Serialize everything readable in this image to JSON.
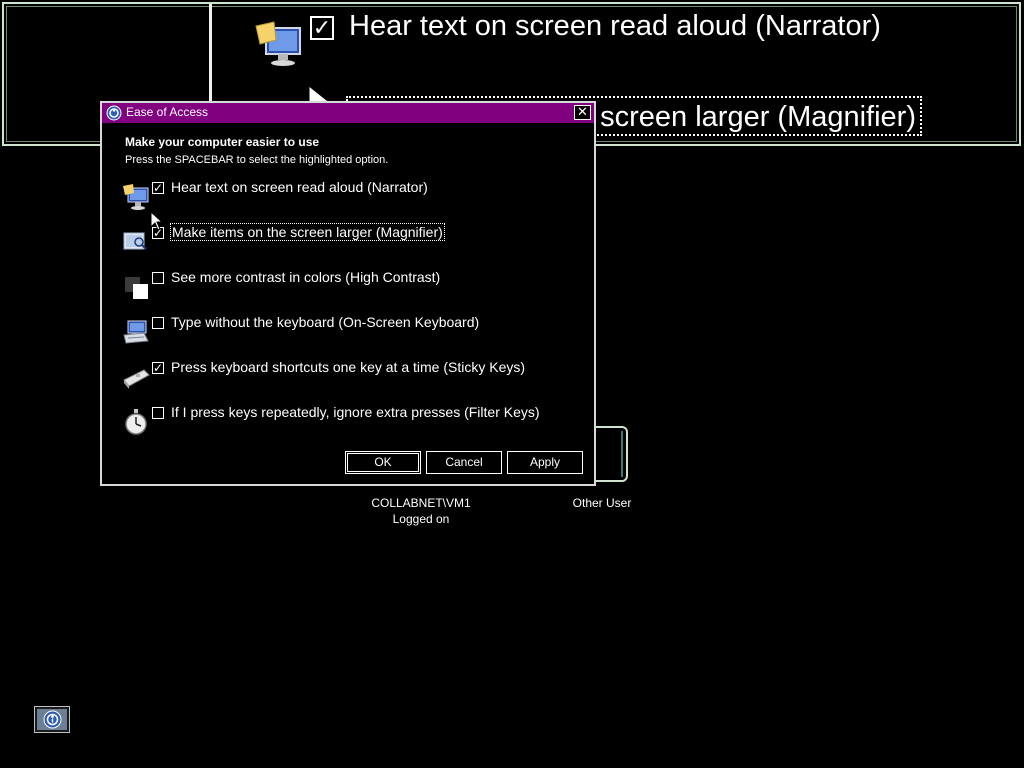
{
  "magnifier": {
    "line1": "Hear text on screen read aloud (Narrator)",
    "line2": "screen larger (Magnifier)",
    "line1_checked": true
  },
  "dialog": {
    "title": "Ease of Access",
    "close_label": "✕",
    "heading": "Make your computer easier to use",
    "subheading": "Press the SPACEBAR to select the highlighted option.",
    "options": [
      {
        "label": "Hear text on screen read aloud (Narrator)",
        "checked": true,
        "icon": "narrator-icon"
      },
      {
        "label": "Make items on the screen larger (Magnifier)",
        "checked": true,
        "icon": "magnifier-icon",
        "focused": true
      },
      {
        "label": "See more contrast in colors (High Contrast)",
        "checked": false,
        "icon": "high-contrast-icon"
      },
      {
        "label": "Type without the keyboard (On-Screen Keyboard)",
        "checked": false,
        "icon": "on-screen-keyboard-icon"
      },
      {
        "label": "Press keyboard shortcuts one key at a time (Sticky Keys)",
        "checked": true,
        "icon": "sticky-keys-icon"
      },
      {
        "label": "If I press keys repeatedly, ignore extra presses (Filter Keys)",
        "checked": false,
        "icon": "filter-keys-icon"
      }
    ],
    "buttons": {
      "ok": "OK",
      "cancel": "Cancel",
      "apply": "Apply"
    }
  },
  "users": {
    "current_user": "COLLABNET\\VM1",
    "current_status": "Logged on",
    "other_user": "Other User"
  },
  "colors": {
    "titlebar": "#800080",
    "background": "#000000",
    "text": "#ffffff",
    "lens_border": "#cfe3cf"
  }
}
